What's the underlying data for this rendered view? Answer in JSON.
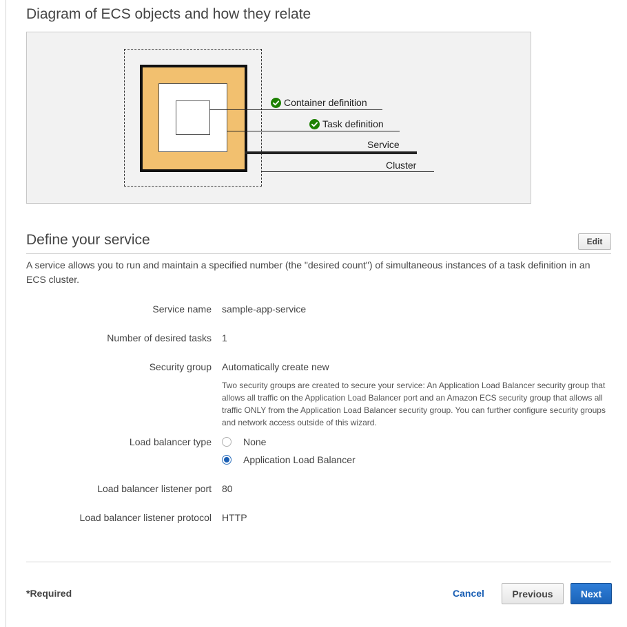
{
  "diagram": {
    "title": "Diagram of ECS objects and how they relate",
    "labels": {
      "container_definition": "Container definition",
      "task_definition": "Task definition",
      "service": "Service",
      "cluster": "Cluster"
    },
    "colors": {
      "service_fill": "#f2c06f",
      "check": "#1d8102"
    },
    "icons": {
      "check": "check-circle-icon"
    }
  },
  "service_section": {
    "title": "Define your service",
    "edit_label": "Edit",
    "description": "A service allows you to run and maintain a specified number (the \"desired count\") of simultaneous instances of a task definition in an ECS cluster.",
    "fields": {
      "service_name": {
        "label": "Service name",
        "value": "sample-app-service"
      },
      "desired_tasks": {
        "label": "Number of desired tasks",
        "value": "1"
      },
      "security_group": {
        "label": "Security group",
        "value": "Automatically create new",
        "help": "Two security groups are created to secure your service: An Application Load Balancer security group that allows all traffic on the Application Load Balancer port and an Amazon ECS security group that allows all traffic ONLY from the Application Load Balancer security group. You can further configure security groups and network access outside of this wizard."
      },
      "load_balancer_type": {
        "label": "Load balancer type",
        "options": [
          {
            "label": "None",
            "selected": false
          },
          {
            "label": "Application Load Balancer",
            "selected": true
          }
        ]
      },
      "listener_port": {
        "label": "Load balancer listener port",
        "value": "80"
      },
      "listener_protocol": {
        "label": "Load balancer listener protocol",
        "value": "HTTP"
      }
    }
  },
  "footer": {
    "required_note": "*Required",
    "cancel_label": "Cancel",
    "previous_label": "Previous",
    "next_label": "Next",
    "colors": {
      "primary": "#1b63b8",
      "link": "#1a5fb4"
    }
  }
}
